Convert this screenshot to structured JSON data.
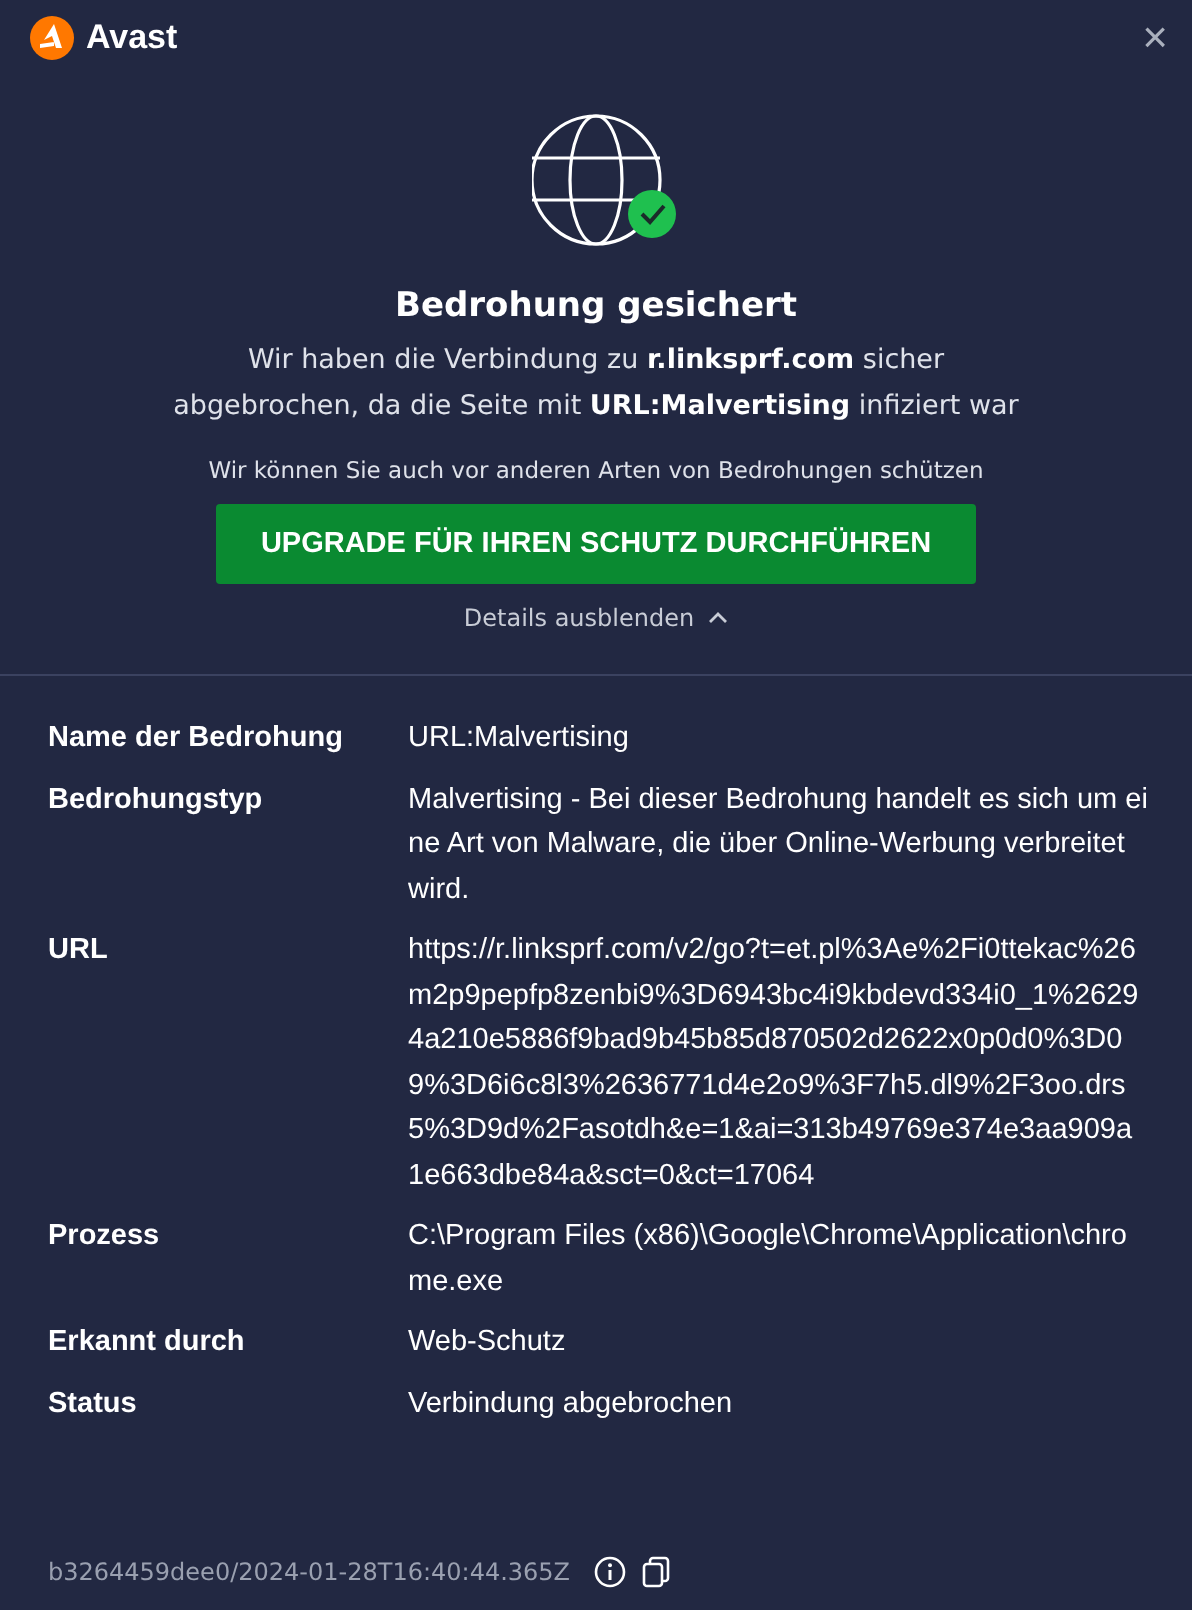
{
  "window": {
    "title": "Avast",
    "close": "×"
  },
  "message": {
    "title": "Bedrohung gesichert",
    "text": "Wir haben die Verbindung zu **r.linksprf.com** sicher abgebrochen, da die Seite mit **URL:Malvertising** infiziert war",
    "note": "Wir können Sie auch vor anderen Arten von Bedrohungen schützen"
  },
  "upgrade_button": "UPGRADE FÜR IHREN SCHUTZ DURCHFÜHREN",
  "details_toggle": {
    "label": "Details ausblenden",
    "expanded": true
  },
  "details": [
    {
      "label": "Name der Bedrohung",
      "value": "URL:Malvertising"
    },
    {
      "label": "Bedrohungstyp",
      "value": "Malvertising - Bei dieser Bedrohung handelt es sich um eine Art von Malware, die über Online-Werbung verbreitet wird."
    },
    {
      "label": "URL",
      "value": "https://r.linksprf.com/v2/go?t=et.pl%3Ae%2Fi0ttekac%26m2p9pepfp8zenbi9%3D6943bc4i9kbdevd334i0_1%26294a210e5886f9bad9b45b85d870502d2622x0p0d0%3D09%3D6i6c8l3%2636771d4e2o9%3F7h5.dl9%2F3oo.drs5%3D9d%2Fasotdh&e=1&ai=313b49769e374e3aa909a1e663dbe84a&sct=0&ct=17064"
    },
    {
      "label": "Prozess",
      "value": "C:\\Program Files (x86)\\Google\\Chrome\\Application\\chrome.exe"
    },
    {
      "label": "Erkannt durch",
      "value": "Web-Schutz"
    },
    {
      "label": "Status",
      "value": "Verbindung abgebrochen"
    }
  ],
  "footer": {
    "id": "b3264459dee0/2024-01-28T16:40:44.365Z"
  }
}
